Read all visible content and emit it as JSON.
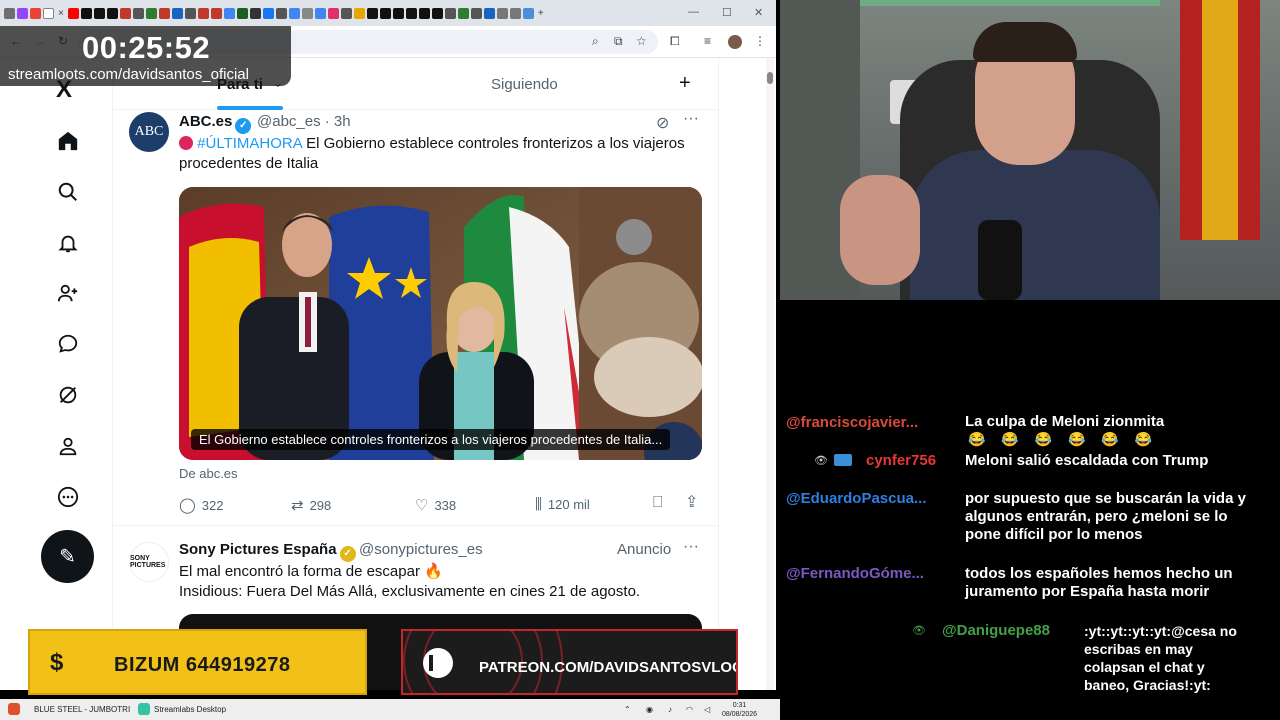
{
  "overlay": {
    "timer": "00:25:52",
    "url": "streamloots.com/davidsantos_oficial"
  },
  "browser": {
    "tab_close": "×",
    "new_tab": "+",
    "win_min": "—",
    "win_max": "☐",
    "win_close": "✕"
  },
  "x_nav": {
    "logo": "X",
    "items": [
      "home-icon",
      "search-icon",
      "notifications-icon",
      "follow-icon",
      "messages-icon",
      "grok-icon",
      "profile-icon",
      "more-icon"
    ],
    "compose_icon": "✎"
  },
  "timeline": {
    "tab_for_you": "Para ti",
    "tab_following": "Siguiendo",
    "plus": "+"
  },
  "tweet1": {
    "avatar_text": "ABC",
    "name": "ABC.es",
    "handle": "@abc_es · 3h",
    "hashtag": "#ÚLTIMAHORA",
    "text": " El Gobierno establece controles fronterizos a los viajeros procedentes de Italia",
    "media_caption": "El Gobierno establece controles fronterizos a los viajeros procedentes de Italia...",
    "source": "De abc.es",
    "replies": "322",
    "reposts": "298",
    "likes": "338",
    "views": "120 mil"
  },
  "tweet2": {
    "avatar_text": "SONY PICTURES",
    "name": "Sony Pictures España",
    "handle": "@sonypictures_es",
    "ad_label": "Anuncio",
    "line1": "El mal encontró la forma de escapar 🔥",
    "line2": "Insidious: Fuera Del Más Allá, exclusivamente en cines 21 de agosto."
  },
  "banners": {
    "bizum_symbol": "$",
    "bizum": "BIZUM 644919278",
    "patreon": "PATREON.COM/DAVIDSANTOSVLOG"
  },
  "taskbar": {
    "item1": "BLUE STEEL - JUMBOTRI",
    "item2": "Streamlabs Desktop",
    "time": "0:31",
    "date": "08/08/2026"
  },
  "chat": {
    "messages": [
      {
        "user": "@franciscojavier...",
        "text": "La culpa de Meloni zionmita",
        "color": "#d94a3a"
      },
      {
        "user": "",
        "text": "😂 😂 😂 😂 😂 😂",
        "color": "#ffffff"
      },
      {
        "user": "cynfer756",
        "text": "Meloni salió escaldada con Trump",
        "color": "#e53935"
      },
      {
        "user": "@EduardoPascua...",
        "text": "por supuesto que se buscarán la vida y algunos entrarán, pero ¿meloni se lo pone difícil por lo menos",
        "color": "#2f7fe0"
      },
      {
        "user": "@FernandoGóme...",
        "text": "todos los españoles hemos hecho un juramento por España hasta morir",
        "color": "#7e57c2"
      },
      {
        "user": "@Daniguepe88",
        "text": ":yt::yt::yt::yt:@cesa no escribas en may colapsan el chat y baneo, Gracias!:yt:",
        "color": "#43a047"
      }
    ]
  }
}
